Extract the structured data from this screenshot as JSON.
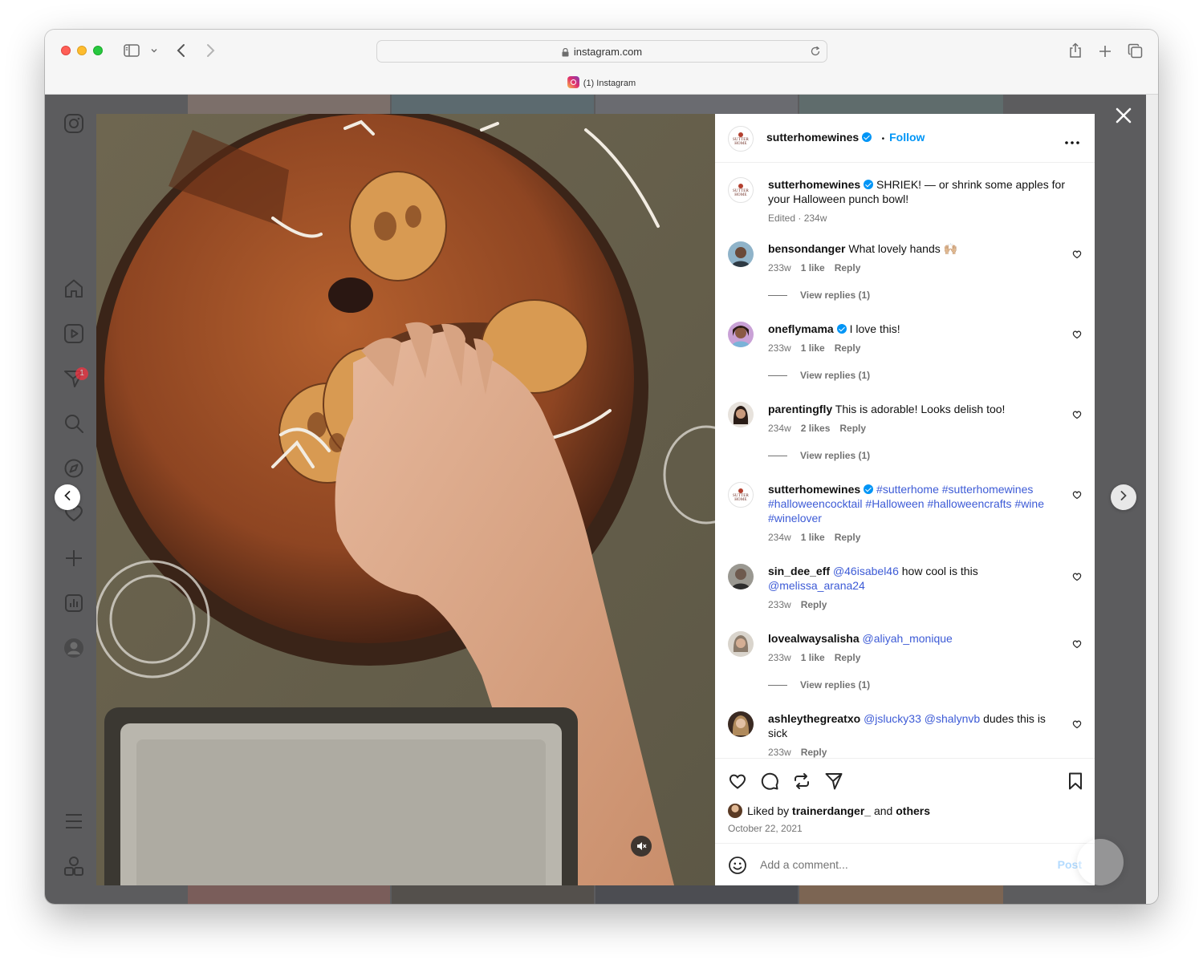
{
  "browser": {
    "url": "instagram.com",
    "tab_title": "(1) Instagram"
  },
  "sidebar": {
    "notification_count": "1",
    "icons": [
      "instagram-logo-icon",
      "home-icon",
      "reels-icon",
      "messages-icon",
      "search-icon",
      "explore-icon",
      "heart-icon",
      "create-icon",
      "dashboard-icon",
      "profile-avatar",
      "menu-icon",
      "threads-icon"
    ]
  },
  "post": {
    "author": "sutterhomewines",
    "follow_label": "Follow",
    "separator": "•",
    "logo_text_top": "SUTTER",
    "logo_text_bottom": "HOME",
    "caption": "SHRIEK! — or shrink some apples for your Halloween punch bowl!",
    "caption_meta": "Edited · 234w",
    "liked_prefix": "Liked by",
    "liked_user": "trainerdanger_",
    "liked_suffix": "and",
    "liked_others": "others",
    "date": "October 22, 2021",
    "add_comment_placeholder": "Add a comment...",
    "post_label": "Post"
  },
  "comments": [
    {
      "user": "bensondanger",
      "text": "What lovely hands 🙌🏼",
      "time": "233w",
      "likes": "1 like",
      "reply": "Reply",
      "replies": "View replies (1)"
    },
    {
      "user": "oneflymama",
      "text": "I love this!",
      "time": "233w",
      "likes": "1 like",
      "reply": "Reply",
      "replies": "View replies (1)"
    },
    {
      "user": "parentingfly",
      "text": "This is adorable! Looks delish too!",
      "time": "234w",
      "likes": "2 likes",
      "reply": "Reply",
      "replies": "View replies (1)"
    },
    {
      "user": "sutterhomewines",
      "text": "#sutterhome #sutterhomewines #halloweencocktail #Halloween #halloweencrafts #wine #winelover",
      "time": "234w",
      "likes": "1 like",
      "reply": "Reply"
    },
    {
      "user": "sin_dee_eff",
      "mention1": "@46isabel46",
      "text": "how cool is this",
      "mention2": "@melissa_arana24",
      "time": "233w",
      "reply": "Reply"
    },
    {
      "user": "lovealwaysalisha",
      "mention1": "@aliyah_monique",
      "time": "233w",
      "likes": "1 like",
      "reply": "Reply",
      "replies": "View replies (1)"
    },
    {
      "user": "ashleythegreatxo",
      "mention1": "@jslucky33",
      "mention2": "@shalynvb",
      "text": "dudes this is sick",
      "time": "233w",
      "reply": "Reply"
    }
  ],
  "colors": {
    "accent": "#0095f6",
    "hashtag": "#3d5bd6",
    "post_disabled": "#b3dbff",
    "badge": "#ff3040"
  }
}
